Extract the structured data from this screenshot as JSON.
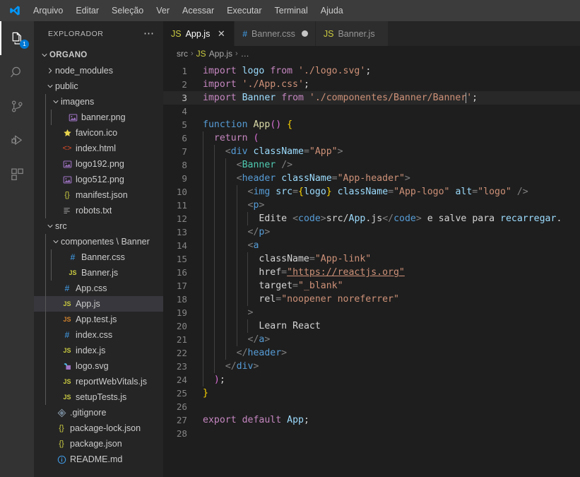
{
  "window": {
    "logo_icon": "vscode-logo-icon"
  },
  "menubar": {
    "items": [
      {
        "label": "Arquivo",
        "name": "menu-arquivo"
      },
      {
        "label": "Editar",
        "name": "menu-editar"
      },
      {
        "label": "Seleção",
        "name": "menu-selecao"
      },
      {
        "label": "Ver",
        "name": "menu-ver"
      },
      {
        "label": "Acessar",
        "name": "menu-acessar"
      },
      {
        "label": "Executar",
        "name": "menu-executar"
      },
      {
        "label": "Terminal",
        "name": "menu-terminal"
      },
      {
        "label": "Ajuda",
        "name": "menu-ajuda"
      }
    ]
  },
  "activitybar": {
    "items": [
      {
        "name": "explorer-icon",
        "label": "Explorer",
        "active": true,
        "badge": "1"
      },
      {
        "name": "search-icon",
        "label": "Search",
        "active": false,
        "badge": ""
      },
      {
        "name": "source-control-icon",
        "label": "Source Control",
        "active": false,
        "badge": ""
      },
      {
        "name": "run-and-debug-icon",
        "label": "Run and Debug",
        "active": false,
        "badge": ""
      },
      {
        "name": "extensions-icon",
        "label": "Extensions",
        "active": false,
        "badge": ""
      }
    ],
    "badge_color": "#0078d4"
  },
  "sidebar": {
    "title": "EXPLORADOR",
    "actions_label": "⋯",
    "tree": [
      {
        "label": "ORGANO",
        "icon": "folder-root",
        "depth": 0,
        "twisty": "down",
        "root": true
      },
      {
        "label": "node_modules",
        "icon": "folder",
        "depth": 1,
        "twisty": "right"
      },
      {
        "label": "public",
        "icon": "folder",
        "depth": 1,
        "twisty": "down"
      },
      {
        "label": "imagens",
        "icon": "folder",
        "depth": 2,
        "twisty": "down"
      },
      {
        "label": "banner.png",
        "icon": "image",
        "depth": 3,
        "twisty": "none"
      },
      {
        "label": "favicon.ico",
        "icon": "star",
        "depth": 2,
        "twisty": "none"
      },
      {
        "label": "index.html",
        "icon": "html",
        "depth": 2,
        "twisty": "none"
      },
      {
        "label": "logo192.png",
        "icon": "image",
        "depth": 2,
        "twisty": "none"
      },
      {
        "label": "logo512.png",
        "icon": "image",
        "depth": 2,
        "twisty": "none"
      },
      {
        "label": "manifest.json",
        "icon": "json",
        "depth": 2,
        "twisty": "none"
      },
      {
        "label": "robots.txt",
        "icon": "text",
        "depth": 2,
        "twisty": "none"
      },
      {
        "label": "src",
        "icon": "folder",
        "depth": 1,
        "twisty": "down"
      },
      {
        "label": "componentes \\ Banner",
        "icon": "folder",
        "depth": 2,
        "twisty": "down"
      },
      {
        "label": "Banner.css",
        "icon": "css",
        "depth": 3,
        "twisty": "none"
      },
      {
        "label": "Banner.js",
        "icon": "js",
        "depth": 3,
        "twisty": "none"
      },
      {
        "label": "App.css",
        "icon": "css",
        "depth": 2,
        "twisty": "none"
      },
      {
        "label": "App.js",
        "icon": "js",
        "depth": 2,
        "twisty": "none",
        "selected": true
      },
      {
        "label": "App.test.js",
        "icon": "test-js",
        "depth": 2,
        "twisty": "none"
      },
      {
        "label": "index.css",
        "icon": "css",
        "depth": 2,
        "twisty": "none"
      },
      {
        "label": "index.js",
        "icon": "js",
        "depth": 2,
        "twisty": "none"
      },
      {
        "label": "logo.svg",
        "icon": "svg",
        "depth": 2,
        "twisty": "none"
      },
      {
        "label": "reportWebVitals.js",
        "icon": "js",
        "depth": 2,
        "twisty": "none"
      },
      {
        "label": "setupTests.js",
        "icon": "js",
        "depth": 2,
        "twisty": "none"
      },
      {
        "label": ".gitignore",
        "icon": "git",
        "depth": 1,
        "twisty": "none"
      },
      {
        "label": "package-lock.json",
        "icon": "json",
        "depth": 1,
        "twisty": "none"
      },
      {
        "label": "package.json",
        "icon": "json",
        "depth": 1,
        "twisty": "none"
      },
      {
        "label": "README.md",
        "icon": "info",
        "depth": 1,
        "twisty": "none"
      }
    ]
  },
  "tabs": [
    {
      "label": "App.js",
      "icon": "js",
      "active": true,
      "dirty": false,
      "close": "✕"
    },
    {
      "label": "Banner.css",
      "icon": "css",
      "active": false,
      "dirty": true,
      "close": ""
    },
    {
      "label": "Banner.js",
      "icon": "js",
      "active": false,
      "dirty": false,
      "close": ""
    }
  ],
  "breadcrumbs": {
    "items": [
      {
        "label": "src",
        "icon": "none"
      },
      {
        "label": "App.js",
        "icon": "js"
      },
      {
        "label": "…",
        "icon": "none"
      }
    ],
    "separator": "›"
  },
  "code": {
    "language": "javascript",
    "cursor_line": 3,
    "lines": [
      {
        "n": 1,
        "text": "import logo from './logo.svg';"
      },
      {
        "n": 2,
        "text": "import './App.css';"
      },
      {
        "n": 3,
        "text": "import Banner from './componentes/Banner/Banner';"
      },
      {
        "n": 4,
        "text": ""
      },
      {
        "n": 5,
        "text": "function App() {"
      },
      {
        "n": 6,
        "text": "  return ("
      },
      {
        "n": 7,
        "text": "    <div className=\"App\">"
      },
      {
        "n": 8,
        "text": "      <Banner />"
      },
      {
        "n": 9,
        "text": "      <header className=\"App-header\">"
      },
      {
        "n": 10,
        "text": "        <img src={logo} className=\"App-logo\" alt=\"logo\" />"
      },
      {
        "n": 11,
        "text": "        <p>"
      },
      {
        "n": 12,
        "text": "          Edite <code>src/App.js</code> e salve para recarregar."
      },
      {
        "n": 13,
        "text": "        </p>"
      },
      {
        "n": 14,
        "text": "        <a"
      },
      {
        "n": 15,
        "text": "          className=\"App-link\""
      },
      {
        "n": 16,
        "text": "          href=\"https://reactjs.org\""
      },
      {
        "n": 17,
        "text": "          target=\"_blank\""
      },
      {
        "n": 18,
        "text": "          rel=\"noopener noreferrer\""
      },
      {
        "n": 19,
        "text": "        >"
      },
      {
        "n": 20,
        "text": "          Learn React"
      },
      {
        "n": 21,
        "text": "        </a>"
      },
      {
        "n": 22,
        "text": "      </header>"
      },
      {
        "n": 23,
        "text": "    </div>"
      },
      {
        "n": 24,
        "text": "  );"
      },
      {
        "n": 25,
        "text": "}"
      },
      {
        "n": 26,
        "text": ""
      },
      {
        "n": 27,
        "text": "export default App;"
      },
      {
        "n": 28,
        "text": ""
      }
    ]
  },
  "theme": {
    "editor_bg": "#1e1e1e",
    "sidebar_bg": "#252526",
    "activitybar_bg": "#333333",
    "titlebar_bg": "#3c3c3c",
    "accent": "#007acc",
    "selection_bg": "#37373d",
    "keyword": "#c586c0",
    "string": "#ce9178",
    "variable": "#9cdcfe",
    "function": "#dcdcaa",
    "tag": "#569cd6",
    "component": "#4ec9b0"
  }
}
